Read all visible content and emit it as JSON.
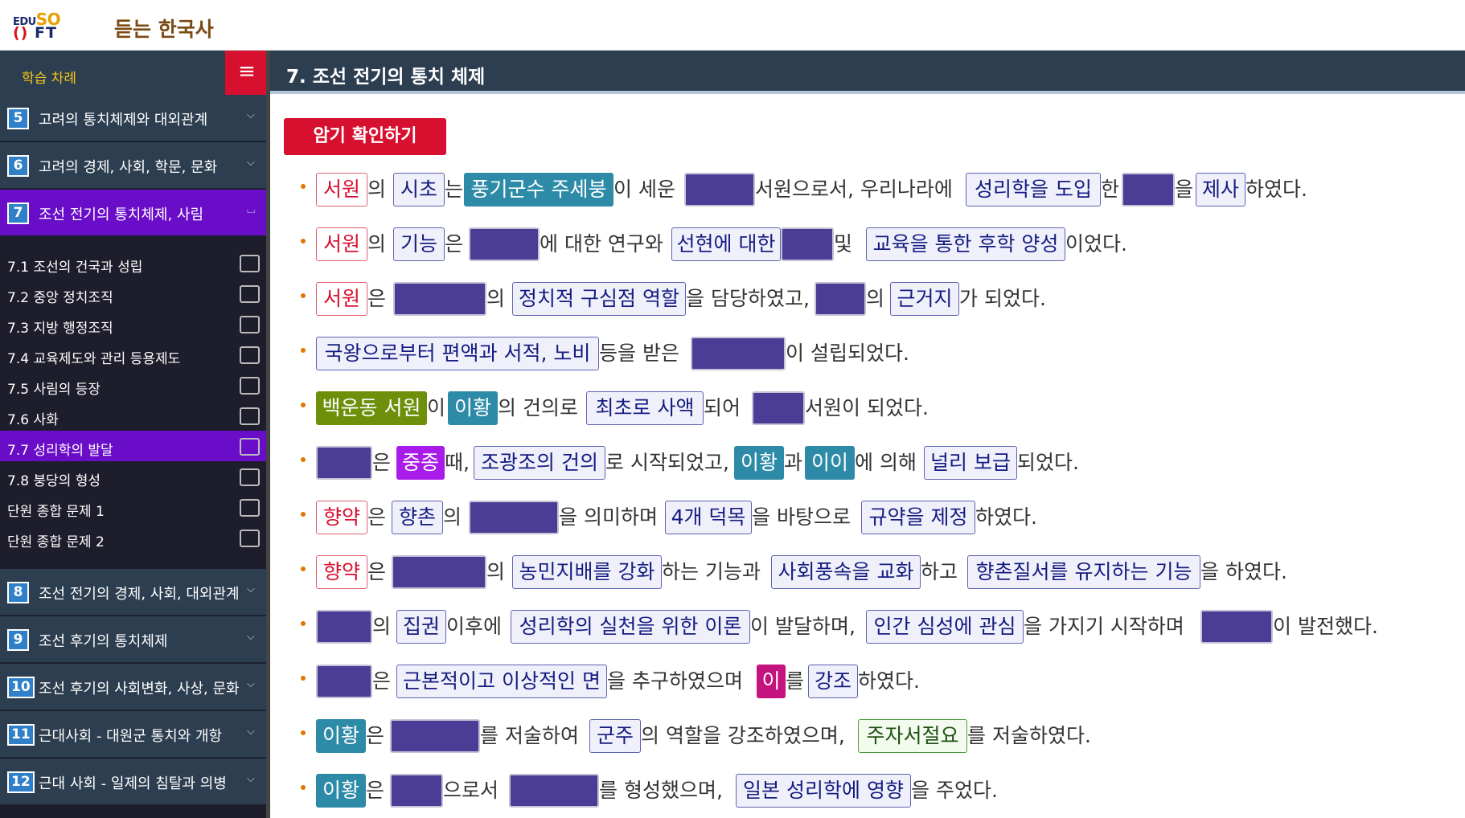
{
  "header": {
    "logo": {
      "l1_pre": "EDU",
      "l1_so": "SO",
      "l2_icon": "()",
      "l2_ft": "FT"
    },
    "title": "듣는 한국사"
  },
  "sidebar": {
    "label": "학습 차례",
    "menu_icon": "≡",
    "units_top": [
      {
        "num": "5",
        "title": "고려의 통치체제와 대외관계"
      },
      {
        "num": "6",
        "title": "고려의 경제, 사회, 학문, 문화"
      },
      {
        "num": "7",
        "title": "조선 전기의 통치체제, 사림"
      }
    ],
    "subitems": [
      "7.1 조선의 건국과 성립",
      "7.2 중앙 정치조직",
      "7.3 지방 행정조직",
      "7.4 교육제도와 관리 등용제도",
      "7.5 사림의 등장",
      "7.6 사화",
      "7.7 성리학의 발달",
      "7.8 붕당의 형성",
      "단원 종합 문제 1",
      "단원 종합 문제 2"
    ],
    "units_bottom": [
      {
        "num": "8",
        "title": "조선 전기의 경제, 사회, 대외관계"
      },
      {
        "num": "9",
        "title": "조선 후기의 통치체제"
      },
      {
        "num": "10",
        "title": "조선 후기의 사회변화, 사상, 문화"
      },
      {
        "num": "11",
        "title": "근대사회 - 대원군 통치와 개항"
      },
      {
        "num": "12",
        "title": "근대 사회 - 일제의 침탈과 의병"
      }
    ]
  },
  "main": {
    "heading": "7. 조선 전기의 통치 체제",
    "quiz_button": "암기 확인하기",
    "rows": [
      [
        [
          "red",
          "서원"
        ],
        [
          "txt",
          "의"
        ],
        [
          "navy",
          "시초"
        ],
        [
          "txt",
          "는"
        ],
        [
          "teal",
          "풍기군수 주세붕"
        ],
        [
          "txt",
          "이 세운"
        ],
        [
          "blank",
          ""
        ],
        [
          "txt",
          "서원으로서, 우리나라에"
        ],
        [
          "navy",
          "성리학을 도입"
        ],
        [
          "txt",
          "한"
        ],
        [
          "blank",
          ""
        ],
        [
          "txt",
          "을"
        ],
        [
          "navy",
          "제사"
        ],
        [
          "txt",
          "하였다."
        ]
      ],
      [
        [
          "red",
          "서원"
        ],
        [
          "txt",
          "의"
        ],
        [
          "navy",
          "기능"
        ],
        [
          "txt",
          "은"
        ],
        [
          "blank",
          ""
        ],
        [
          "txt",
          "에 대한 연구와"
        ],
        [
          "navy",
          "선현에 대한"
        ],
        [
          "blank",
          ""
        ],
        [
          "txt",
          "및"
        ],
        [
          "navy",
          "교육을 통한 후학 양성"
        ],
        [
          "txt",
          "이었다."
        ]
      ],
      [
        [
          "red",
          "서원"
        ],
        [
          "txt",
          "은"
        ],
        [
          "blank",
          ""
        ],
        [
          "txt",
          "의"
        ],
        [
          "navy",
          "정치적 구심점 역할"
        ],
        [
          "txt",
          "을 담당하였고,"
        ],
        [
          "blank",
          ""
        ],
        [
          "txt",
          "의"
        ],
        [
          "navy",
          "근거지"
        ],
        [
          "txt",
          "가 되었다."
        ]
      ],
      [
        [
          "navy",
          "국왕으로부터 편액과 서적, 노비"
        ],
        [
          "txt",
          "등을 받은"
        ],
        [
          "blank",
          ""
        ],
        [
          "txt",
          "이 설립되었다."
        ]
      ],
      [
        [
          "olive",
          "백운동 서원"
        ],
        [
          "txt",
          "이"
        ],
        [
          "teal",
          "이황"
        ],
        [
          "txt",
          "의 건의로"
        ],
        [
          "navy",
          "최초로 사액"
        ],
        [
          "txt",
          "되어"
        ],
        [
          "blank",
          ""
        ],
        [
          "txt",
          "서원이 되었다."
        ]
      ],
      [
        [
          "blank",
          ""
        ],
        [
          "txt",
          "은"
        ],
        [
          "violet",
          "중종"
        ],
        [
          "txt",
          "때,"
        ],
        [
          "navy",
          "조광조의 건의"
        ],
        [
          "txt",
          "로 시작되었고,"
        ],
        [
          "teal",
          "이황"
        ],
        [
          "txt",
          "과"
        ],
        [
          "teal",
          "이이"
        ],
        [
          "txt",
          "에 의해"
        ],
        [
          "navy",
          "널리 보급"
        ],
        [
          "txt",
          "되었다."
        ]
      ],
      [
        [
          "red",
          "향약"
        ],
        [
          "txt",
          "은"
        ],
        [
          "navy",
          "향촌"
        ],
        [
          "txt",
          "의"
        ],
        [
          "blank",
          ""
        ],
        [
          "txt",
          "을 의미하며"
        ],
        [
          "navy",
          "4개 덕목"
        ],
        [
          "txt",
          "을 바탕으로"
        ],
        [
          "navy",
          "규약을 제정"
        ],
        [
          "txt",
          "하였다."
        ]
      ],
      [
        [
          "red",
          "향약"
        ],
        [
          "txt",
          "은"
        ],
        [
          "blank",
          ""
        ],
        [
          "txt",
          "의"
        ],
        [
          "navy",
          "농민지배를 강화"
        ],
        [
          "txt",
          "하는 기능과"
        ],
        [
          "navy",
          "사회풍속을 교화"
        ],
        [
          "txt",
          "하고"
        ],
        [
          "navy",
          "향촌질서를 유지하는 기능"
        ],
        [
          "txt",
          "을 하였다."
        ]
      ],
      [
        [
          "blank",
          ""
        ],
        [
          "txt",
          "의"
        ],
        [
          "navy",
          "집권"
        ],
        [
          "txt",
          "이후에"
        ],
        [
          "navy",
          "성리학의 실천을 위한 이론"
        ],
        [
          "txt",
          "이 발달하며,"
        ],
        [
          "navy",
          "인간 심성에 관심"
        ],
        [
          "txt",
          "을 가지기 시작하며"
        ],
        [
          "blank",
          ""
        ],
        [
          "txt",
          "이 발전했다."
        ]
      ],
      [
        [
          "blank",
          ""
        ],
        [
          "txt",
          "은"
        ],
        [
          "navy",
          "근본적이고 이상적인 면"
        ],
        [
          "txt",
          "을 추구하였으며"
        ],
        [
          "magenta",
          "이"
        ],
        [
          "txt",
          "를"
        ],
        [
          "navy",
          "강조"
        ],
        [
          "txt",
          "하였다."
        ]
      ],
      [
        [
          "teal",
          "이황"
        ],
        [
          "txt",
          "은"
        ],
        [
          "blank",
          ""
        ],
        [
          "txt",
          "를 저술하여"
        ],
        [
          "navy",
          "군주"
        ],
        [
          "txt",
          "의 역할을 강조하였으며,"
        ],
        [
          "green",
          "주자서절요"
        ],
        [
          "txt",
          "를 저술하였다."
        ]
      ],
      [
        [
          "teal",
          "이황"
        ],
        [
          "txt",
          "은"
        ],
        [
          "blank",
          ""
        ],
        [
          "txt",
          "으로서"
        ],
        [
          "blank",
          ""
        ],
        [
          "txt",
          "를 형성했으며,"
        ],
        [
          "navy",
          "일본 성리학에 영향"
        ],
        [
          "txt",
          "을 주었다."
        ]
      ]
    ]
  }
}
